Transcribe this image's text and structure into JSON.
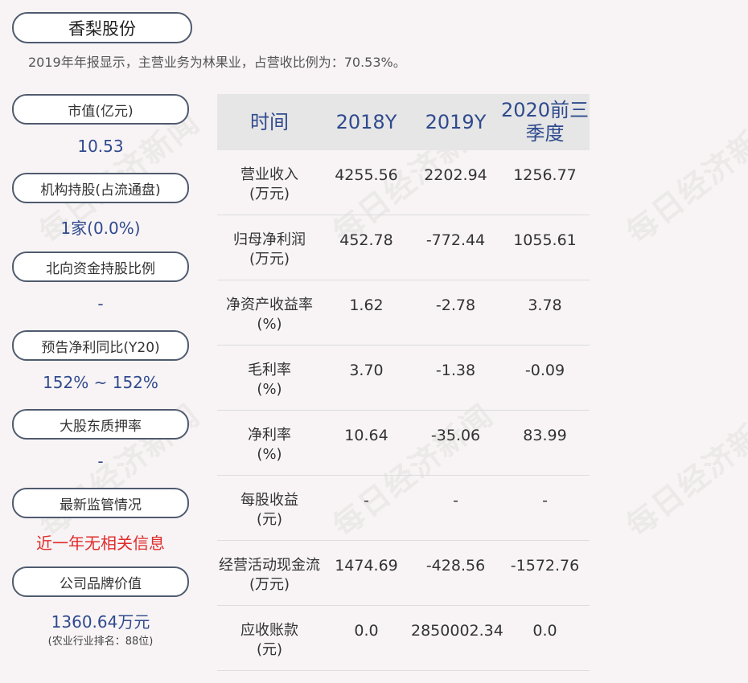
{
  "company": {
    "name": "香梨股份",
    "summary": "2019年年报显示，主营业务为林果业，占营收比例为：70.53%。"
  },
  "watermark": "每日经济新闻",
  "stats": [
    {
      "label": "市值(亿元)",
      "value": "10.53"
    },
    {
      "label": "机构持股(占流通盘)",
      "value": "1家(0.0%)"
    },
    {
      "label": "北向资金持股比例",
      "value": "-"
    },
    {
      "label": "预告净利同比(Y20)",
      "value": "152% ~ 152%"
    },
    {
      "label": "大股东质押率",
      "value": "-"
    },
    {
      "label": "最新监管情况",
      "value": "近一年无相关信息"
    },
    {
      "label": "公司品牌价值",
      "value": "1360.64万元",
      "note": "(农业行业排名：88位)"
    }
  ],
  "table": {
    "headers": [
      "时间",
      "2018Y",
      "2019Y",
      "2020前三季度"
    ],
    "rows": [
      {
        "label": "营业收入",
        "unit": "(万元)",
        "values": [
          "4255.56",
          "2202.94",
          "1256.77"
        ]
      },
      {
        "label": "归母净利润",
        "unit": "(万元)",
        "values": [
          "452.78",
          "-772.44",
          "1055.61"
        ]
      },
      {
        "label": "净资产收益率",
        "unit": "(%)",
        "values": [
          "1.62",
          "-2.78",
          "3.78"
        ]
      },
      {
        "label": "毛利率",
        "unit": "(%)",
        "values": [
          "3.70",
          "-1.38",
          "-0.09"
        ]
      },
      {
        "label": "净利率",
        "unit": "(%)",
        "values": [
          "10.64",
          "-35.06",
          "83.99"
        ]
      },
      {
        "label": "每股收益",
        "unit": "(元)",
        "values": [
          "-",
          "-",
          "-"
        ]
      },
      {
        "label": "经营活动现金流",
        "unit": "(万元)",
        "values": [
          "1474.69",
          "-428.56",
          "-1572.76"
        ]
      },
      {
        "label": "应收账款",
        "unit": "(元)",
        "values": [
          "0.0",
          "2850002.34",
          "0.0"
        ]
      }
    ]
  },
  "colors": {
    "accent_blue": "#2f4a8e",
    "alert_red": "#e02b2b",
    "border": "#4f5b6e"
  }
}
